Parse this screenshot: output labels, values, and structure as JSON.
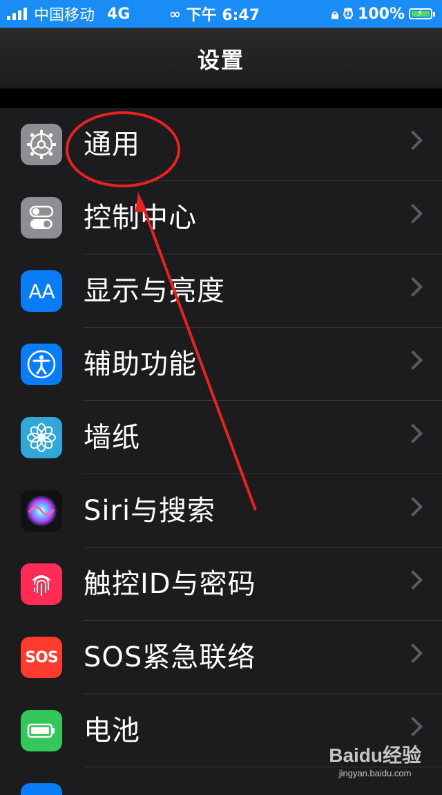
{
  "status_bar": {
    "carrier": "中国移动",
    "network": "4G",
    "time": "下午 6:47",
    "battery": "100%"
  },
  "nav": {
    "title": "设置"
  },
  "settings": [
    {
      "label": "通用",
      "icon": "gear-icon",
      "color": "#8e8e93"
    },
    {
      "label": "控制中心",
      "icon": "toggles-icon",
      "color": "#8e8e93"
    },
    {
      "label": "显示与亮度",
      "icon": "aa-icon",
      "icon_text": "AA",
      "color": "#0a7cf5"
    },
    {
      "label": "辅助功能",
      "icon": "accessibility-icon",
      "color": "#0a7cf5"
    },
    {
      "label": "墙纸",
      "icon": "flower-icon",
      "color": "#30a6d9"
    },
    {
      "label": "Siri与搜索",
      "icon": "siri-icon",
      "color": "#111111"
    },
    {
      "label": "触控ID与密码",
      "icon": "fingerprint-icon",
      "color": "#ff2d55"
    },
    {
      "label": "SOS紧急联络",
      "icon": "sos-icon",
      "icon_text": "SOS",
      "color": "#ff3b30"
    },
    {
      "label": "电池",
      "icon": "battery-icon",
      "color": "#34c759"
    }
  ],
  "annotation": {
    "highlighted_item": "通用",
    "color": "#e8231f"
  },
  "watermark": {
    "logo": "Baidu经验",
    "sub": "jingyan.baidu.com"
  }
}
